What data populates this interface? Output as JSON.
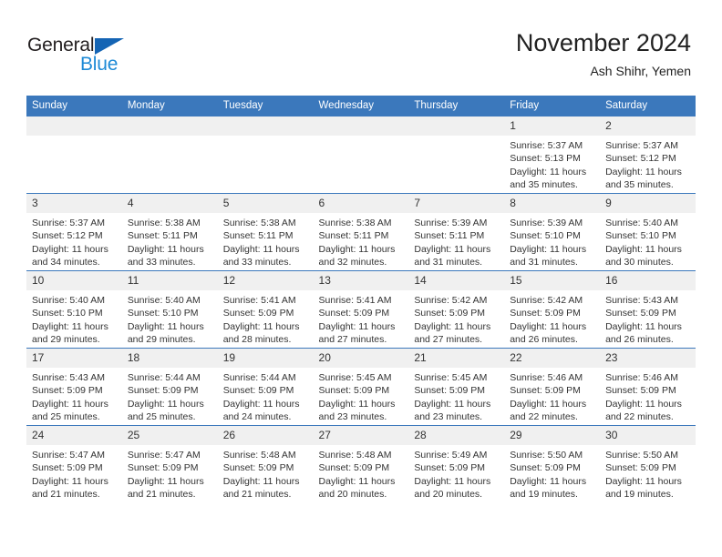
{
  "brand": {
    "name_part1": "General",
    "name_part2": "Blue",
    "triangle_color": "#1464b4",
    "blue_color": "#1e8ad6"
  },
  "header": {
    "month_title": "November 2024",
    "location": "Ash Shihr, Yemen"
  },
  "theme": {
    "header_blue": "#3b78bc",
    "daynum_band": "#f0f0f0",
    "text": "#333333"
  },
  "weekdays": [
    "Sunday",
    "Monday",
    "Tuesday",
    "Wednesday",
    "Thursday",
    "Friday",
    "Saturday"
  ],
  "labels": {
    "sunrise_prefix": "Sunrise:",
    "sunset_prefix": "Sunset:",
    "daylight_prefix": "Daylight:"
  },
  "weeks": [
    [
      {
        "day": "",
        "blank": true
      },
      {
        "day": "",
        "blank": true
      },
      {
        "day": "",
        "blank": true
      },
      {
        "day": "",
        "blank": true
      },
      {
        "day": "",
        "blank": true
      },
      {
        "day": "1",
        "sunrise": "Sunrise: 5:37 AM",
        "sunset": "Sunset: 5:13 PM",
        "daylight": "Daylight: 11 hours and 35 minutes."
      },
      {
        "day": "2",
        "sunrise": "Sunrise: 5:37 AM",
        "sunset": "Sunset: 5:12 PM",
        "daylight": "Daylight: 11 hours and 35 minutes."
      }
    ],
    [
      {
        "day": "3",
        "sunrise": "Sunrise: 5:37 AM",
        "sunset": "Sunset: 5:12 PM",
        "daylight": "Daylight: 11 hours and 34 minutes."
      },
      {
        "day": "4",
        "sunrise": "Sunrise: 5:38 AM",
        "sunset": "Sunset: 5:11 PM",
        "daylight": "Daylight: 11 hours and 33 minutes."
      },
      {
        "day": "5",
        "sunrise": "Sunrise: 5:38 AM",
        "sunset": "Sunset: 5:11 PM",
        "daylight": "Daylight: 11 hours and 33 minutes."
      },
      {
        "day": "6",
        "sunrise": "Sunrise: 5:38 AM",
        "sunset": "Sunset: 5:11 PM",
        "daylight": "Daylight: 11 hours and 32 minutes."
      },
      {
        "day": "7",
        "sunrise": "Sunrise: 5:39 AM",
        "sunset": "Sunset: 5:11 PM",
        "daylight": "Daylight: 11 hours and 31 minutes."
      },
      {
        "day": "8",
        "sunrise": "Sunrise: 5:39 AM",
        "sunset": "Sunset: 5:10 PM",
        "daylight": "Daylight: 11 hours and 31 minutes."
      },
      {
        "day": "9",
        "sunrise": "Sunrise: 5:40 AM",
        "sunset": "Sunset: 5:10 PM",
        "daylight": "Daylight: 11 hours and 30 minutes."
      }
    ],
    [
      {
        "day": "10",
        "sunrise": "Sunrise: 5:40 AM",
        "sunset": "Sunset: 5:10 PM",
        "daylight": "Daylight: 11 hours and 29 minutes."
      },
      {
        "day": "11",
        "sunrise": "Sunrise: 5:40 AM",
        "sunset": "Sunset: 5:10 PM",
        "daylight": "Daylight: 11 hours and 29 minutes."
      },
      {
        "day": "12",
        "sunrise": "Sunrise: 5:41 AM",
        "sunset": "Sunset: 5:09 PM",
        "daylight": "Daylight: 11 hours and 28 minutes."
      },
      {
        "day": "13",
        "sunrise": "Sunrise: 5:41 AM",
        "sunset": "Sunset: 5:09 PM",
        "daylight": "Daylight: 11 hours and 27 minutes."
      },
      {
        "day": "14",
        "sunrise": "Sunrise: 5:42 AM",
        "sunset": "Sunset: 5:09 PM",
        "daylight": "Daylight: 11 hours and 27 minutes."
      },
      {
        "day": "15",
        "sunrise": "Sunrise: 5:42 AM",
        "sunset": "Sunset: 5:09 PM",
        "daylight": "Daylight: 11 hours and 26 minutes."
      },
      {
        "day": "16",
        "sunrise": "Sunrise: 5:43 AM",
        "sunset": "Sunset: 5:09 PM",
        "daylight": "Daylight: 11 hours and 26 minutes."
      }
    ],
    [
      {
        "day": "17",
        "sunrise": "Sunrise: 5:43 AM",
        "sunset": "Sunset: 5:09 PM",
        "daylight": "Daylight: 11 hours and 25 minutes."
      },
      {
        "day": "18",
        "sunrise": "Sunrise: 5:44 AM",
        "sunset": "Sunset: 5:09 PM",
        "daylight": "Daylight: 11 hours and 25 minutes."
      },
      {
        "day": "19",
        "sunrise": "Sunrise: 5:44 AM",
        "sunset": "Sunset: 5:09 PM",
        "daylight": "Daylight: 11 hours and 24 minutes."
      },
      {
        "day": "20",
        "sunrise": "Sunrise: 5:45 AM",
        "sunset": "Sunset: 5:09 PM",
        "daylight": "Daylight: 11 hours and 23 minutes."
      },
      {
        "day": "21",
        "sunrise": "Sunrise: 5:45 AM",
        "sunset": "Sunset: 5:09 PM",
        "daylight": "Daylight: 11 hours and 23 minutes."
      },
      {
        "day": "22",
        "sunrise": "Sunrise: 5:46 AM",
        "sunset": "Sunset: 5:09 PM",
        "daylight": "Daylight: 11 hours and 22 minutes."
      },
      {
        "day": "23",
        "sunrise": "Sunrise: 5:46 AM",
        "sunset": "Sunset: 5:09 PM",
        "daylight": "Daylight: 11 hours and 22 minutes."
      }
    ],
    [
      {
        "day": "24",
        "sunrise": "Sunrise: 5:47 AM",
        "sunset": "Sunset: 5:09 PM",
        "daylight": "Daylight: 11 hours and 21 minutes."
      },
      {
        "day": "25",
        "sunrise": "Sunrise: 5:47 AM",
        "sunset": "Sunset: 5:09 PM",
        "daylight": "Daylight: 11 hours and 21 minutes."
      },
      {
        "day": "26",
        "sunrise": "Sunrise: 5:48 AM",
        "sunset": "Sunset: 5:09 PM",
        "daylight": "Daylight: 11 hours and 21 minutes."
      },
      {
        "day": "27",
        "sunrise": "Sunrise: 5:48 AM",
        "sunset": "Sunset: 5:09 PM",
        "daylight": "Daylight: 11 hours and 20 minutes."
      },
      {
        "day": "28",
        "sunrise": "Sunrise: 5:49 AM",
        "sunset": "Sunset: 5:09 PM",
        "daylight": "Daylight: 11 hours and 20 minutes."
      },
      {
        "day": "29",
        "sunrise": "Sunrise: 5:50 AM",
        "sunset": "Sunset: 5:09 PM",
        "daylight": "Daylight: 11 hours and 19 minutes."
      },
      {
        "day": "30",
        "sunrise": "Sunrise: 5:50 AM",
        "sunset": "Sunset: 5:09 PM",
        "daylight": "Daylight: 11 hours and 19 minutes."
      }
    ]
  ]
}
